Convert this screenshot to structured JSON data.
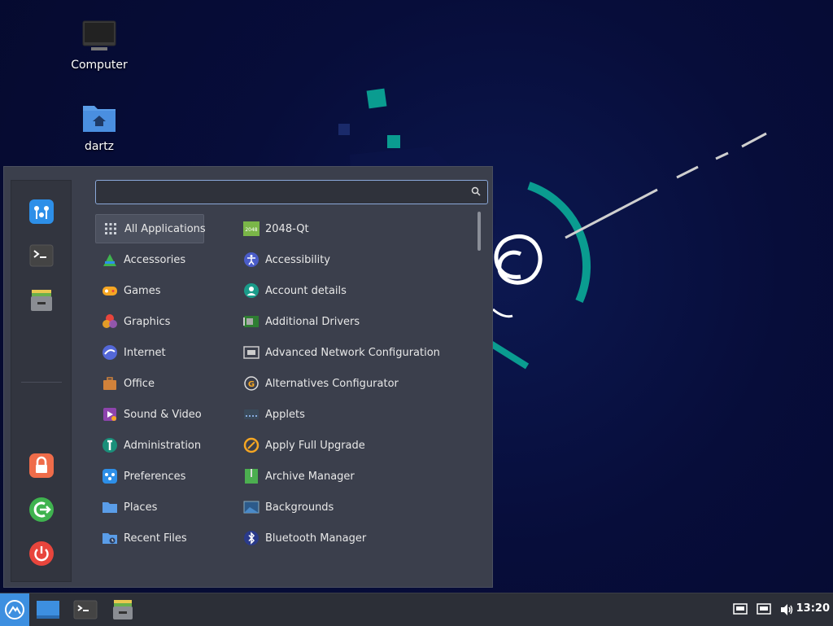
{
  "desktop": {
    "icons": [
      {
        "label": "Computer",
        "icon": "monitor-icon"
      },
      {
        "label": "dartz",
        "icon": "home-folder-icon"
      }
    ],
    "wallpaper": "debian-swirl-dark-blue"
  },
  "menu": {
    "search": {
      "value": "",
      "placeholder": ""
    },
    "favorites": [
      {
        "name": "Settings",
        "icon": "settings-icon"
      },
      {
        "name": "Terminal",
        "icon": "terminal-icon"
      },
      {
        "name": "Files",
        "icon": "file-manager-icon"
      }
    ],
    "session": [
      {
        "name": "Lock Screen",
        "icon": "lock-icon"
      },
      {
        "name": "Log Out",
        "icon": "logout-icon"
      },
      {
        "name": "Quit",
        "icon": "power-icon"
      }
    ],
    "categories": [
      {
        "label": "All Applications",
        "icon": "grid-icon",
        "selected": true
      },
      {
        "label": "Accessories",
        "icon": "accessories-icon"
      },
      {
        "label": "Games",
        "icon": "gamepad-icon"
      },
      {
        "label": "Graphics",
        "icon": "graphics-icon"
      },
      {
        "label": "Internet",
        "icon": "internet-icon"
      },
      {
        "label": "Office",
        "icon": "briefcase-icon"
      },
      {
        "label": "Sound & Video",
        "icon": "multimedia-icon"
      },
      {
        "label": "Administration",
        "icon": "wrench-icon"
      },
      {
        "label": "Preferences",
        "icon": "preferences-icon"
      },
      {
        "label": "Places",
        "icon": "folder-icon"
      },
      {
        "label": "Recent Files",
        "icon": "recent-folder-icon"
      }
    ],
    "apps": [
      {
        "label": "2048-Qt",
        "icon": "2048-icon"
      },
      {
        "label": "Accessibility",
        "icon": "accessibility-icon"
      },
      {
        "label": "Account details",
        "icon": "account-icon"
      },
      {
        "label": "Additional Drivers",
        "icon": "drivers-icon"
      },
      {
        "label": "Advanced Network Configuration",
        "icon": "network-icon"
      },
      {
        "label": "Alternatives Configurator",
        "icon": "alternatives-icon"
      },
      {
        "label": "Applets",
        "icon": "applets-icon"
      },
      {
        "label": "Apply Full Upgrade",
        "icon": "upgrade-icon"
      },
      {
        "label": "Archive Manager",
        "icon": "archive-icon"
      },
      {
        "label": "Backgrounds",
        "icon": "backgrounds-icon"
      },
      {
        "label": "Bluetooth Manager",
        "icon": "bluetooth-icon"
      }
    ]
  },
  "panel": {
    "launchers": [
      {
        "name": "Menu",
        "icon": "menu-icon"
      },
      {
        "name": "Show Desktop",
        "icon": "show-desktop-icon"
      },
      {
        "name": "Terminal",
        "icon": "terminal-icon"
      },
      {
        "name": "Files",
        "icon": "file-manager-icon"
      }
    ],
    "tray": [
      {
        "name": "Network 1",
        "icon": "network-wired-icon"
      },
      {
        "name": "Network 2",
        "icon": "network-wired-icon"
      },
      {
        "name": "Volume",
        "icon": "volume-icon"
      }
    ],
    "clock": "13:20"
  },
  "colors": {
    "accent": "#3d8fe0",
    "teal": "#0a9c90",
    "menu_bg": "#3b3f4c",
    "panel_bg": "#2c2f37"
  }
}
